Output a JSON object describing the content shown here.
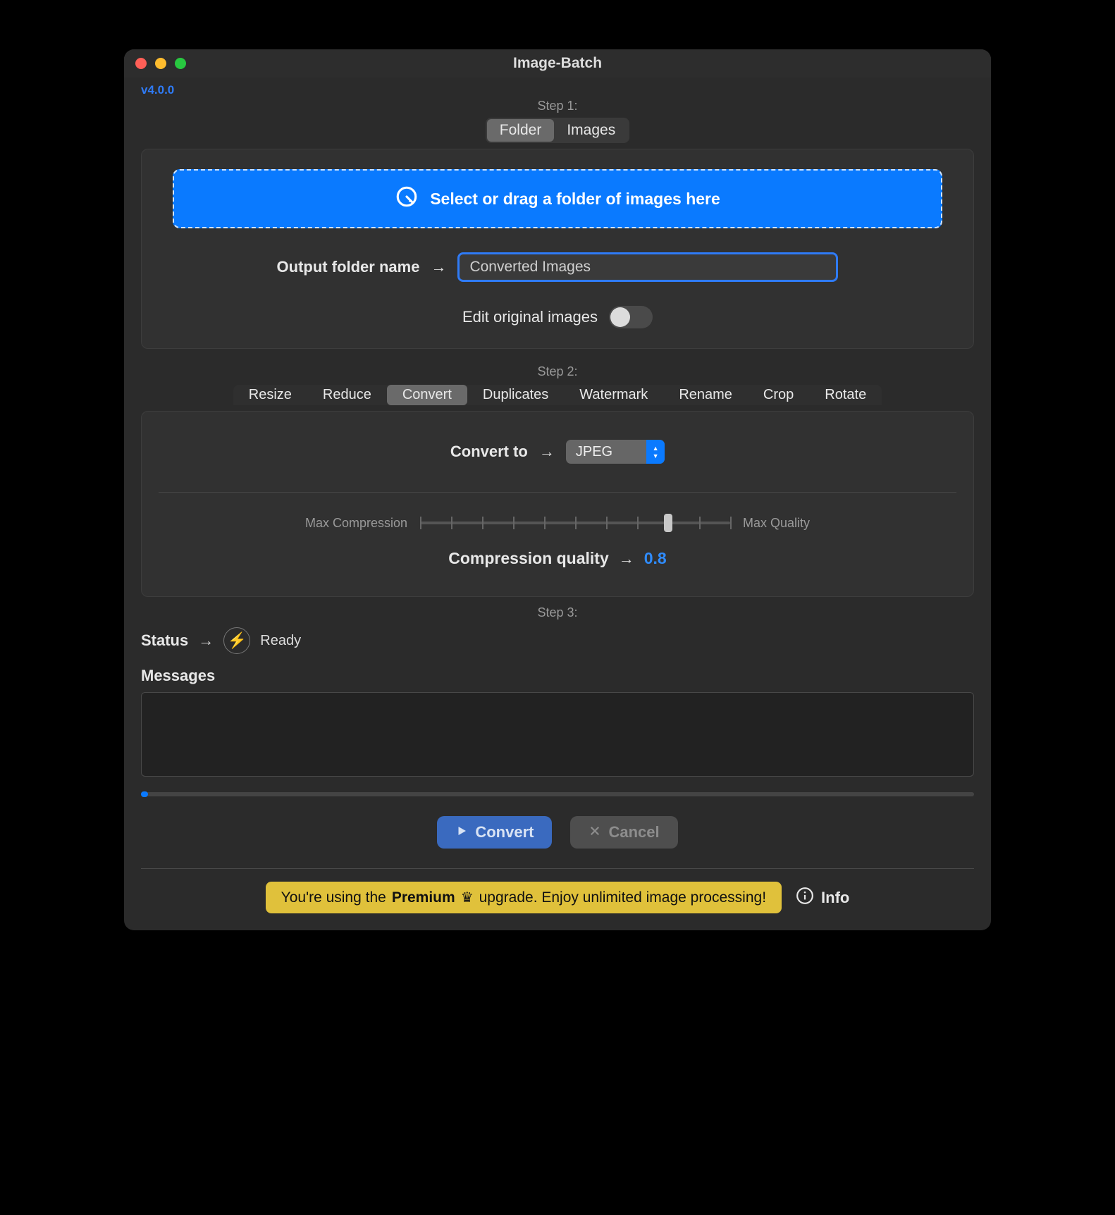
{
  "window": {
    "title": "Image-Batch"
  },
  "version": "v4.0.0",
  "step1": {
    "label": "Step 1:",
    "tabs": {
      "folder": "Folder",
      "images": "Images"
    },
    "dropzone": "Select or drag a folder of images here",
    "outputLabel": "Output folder name",
    "outputValue": "Converted Images",
    "editOriginalLabel": "Edit original images"
  },
  "step2": {
    "label": "Step 2:",
    "tabs": [
      "Resize",
      "Reduce",
      "Convert",
      "Duplicates",
      "Watermark",
      "Rename",
      "Crop",
      "Rotate"
    ],
    "activeTab": "Convert",
    "convertToLabel": "Convert to",
    "convertToValue": "JPEG",
    "sliderLeft": "Max Compression",
    "sliderRight": "Max Quality",
    "qualityLabel": "Compression quality",
    "qualityValue": "0.8"
  },
  "step3": {
    "label": "Step 3:",
    "statusLabel": "Status",
    "statusValue": "Ready",
    "messagesLabel": "Messages"
  },
  "actions": {
    "convert": "Convert",
    "cancel": "Cancel"
  },
  "footer": {
    "bannerA": "You're using the",
    "bannerPremium": "Premium",
    "bannerB": "upgrade. Enjoy unlimited image processing!",
    "info": "Info"
  },
  "colors": {
    "accent": "#0a7aff",
    "link": "#2f7bf6"
  }
}
